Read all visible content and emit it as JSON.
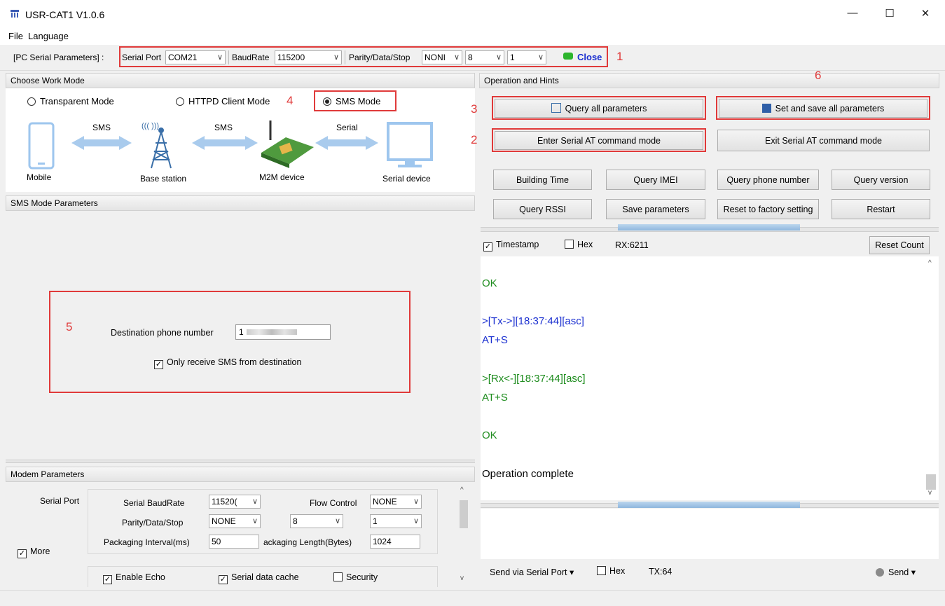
{
  "window": {
    "title": "USR-CAT1 V1.0.6",
    "minimize": "—",
    "maximize": "☐",
    "close": "✕"
  },
  "menu": [
    "File",
    "Language"
  ],
  "serial_bar": {
    "prefix": "[PC Serial Parameters] :",
    "serial_port_label": "Serial Port",
    "serial_port_value": "COM21",
    "baudrate_label": "BaudRate",
    "baudrate_value": "115200",
    "parity_label": "Parity/Data/Stop",
    "parity_value": "NONI",
    "data_value": "8",
    "stop_value": "1",
    "close_label": "Close",
    "status_color": "#2db52d"
  },
  "annotations": {
    "n1": "1",
    "n2": "2",
    "n3": "3",
    "n4": "4",
    "n5": "5",
    "n6": "6"
  },
  "work_mode": {
    "header": "Choose Work Mode",
    "transparent": "Transparent Mode",
    "httpd": "HTTPD Client Mode",
    "sms": "SMS Mode",
    "selected": "SMS Mode",
    "diagram": {
      "sms1": "SMS",
      "sms2": "SMS",
      "serial": "Serial",
      "mobile": "Mobile",
      "base": "Base station",
      "m2m": "M2M device",
      "device": "Serial device",
      "tower_waves": "((( )))"
    }
  },
  "sms_params": {
    "header": "SMS Mode Parameters",
    "dest_label": "Destination phone number",
    "dest_value": "1",
    "only_receive": "Only receive SMS from destination",
    "only_receive_checked": true
  },
  "modem": {
    "header": "Modem Parameters",
    "serial_port": "Serial Port",
    "more": "More",
    "more_checked": true,
    "baud_label": "Serial BaudRate",
    "baud_value": "11520(",
    "flow_label": "Flow Control",
    "flow_value": "NONE",
    "parity_label": "Parity/Data/Stop",
    "parity_value": "NONE",
    "data_value": "8",
    "stop_value": "1",
    "pack_interval_label": "Packaging Interval(ms)",
    "pack_interval_value": "50",
    "pack_length_label": "ackaging Length(Bytes)",
    "pack_length_value": "1024",
    "echo": "Enable Echo",
    "cache": "Serial data cache",
    "security": "Security"
  },
  "ops": {
    "header": "Operation and Hints",
    "query_all": "Query all parameters",
    "set_save_all": "Set and save all parameters",
    "enter_at": "Enter Serial AT command mode",
    "exit_at": "Exit Serial AT command mode",
    "building_time": "Building Time",
    "query_imei": "Query IMEI",
    "query_phone": "Query phone number",
    "query_version": "Query version",
    "query_rssi": "Query RSSI",
    "save_params": "Save parameters",
    "reset_factory": "Reset to factory setting",
    "restart": "Restart"
  },
  "rx_bar": {
    "timestamp": "Timestamp",
    "timestamp_checked": true,
    "hex": "Hex",
    "rx": "RX:6211",
    "reset_count": "Reset Count"
  },
  "log": [
    {
      "text": "OK",
      "color": "#1e8c1e"
    },
    {
      "text": ">[Tx->][18:37:44][asc]",
      "color": "#1a2fd0"
    },
    {
      "text": "AT+S",
      "color": "#1a2fd0"
    },
    {
      "text": ">[Rx<-][18:37:44][asc]",
      "color": "#1e8c1e"
    },
    {
      "text": "AT+S",
      "color": "#1e8c1e"
    },
    {
      "text": "OK",
      "color": "#1e8c1e"
    },
    {
      "text": "Operation complete",
      "color": "#000000"
    }
  ],
  "send_bar": {
    "send_via": "Send via Serial Port",
    "hex": "Hex",
    "tx": "TX:64",
    "send": "Send"
  }
}
